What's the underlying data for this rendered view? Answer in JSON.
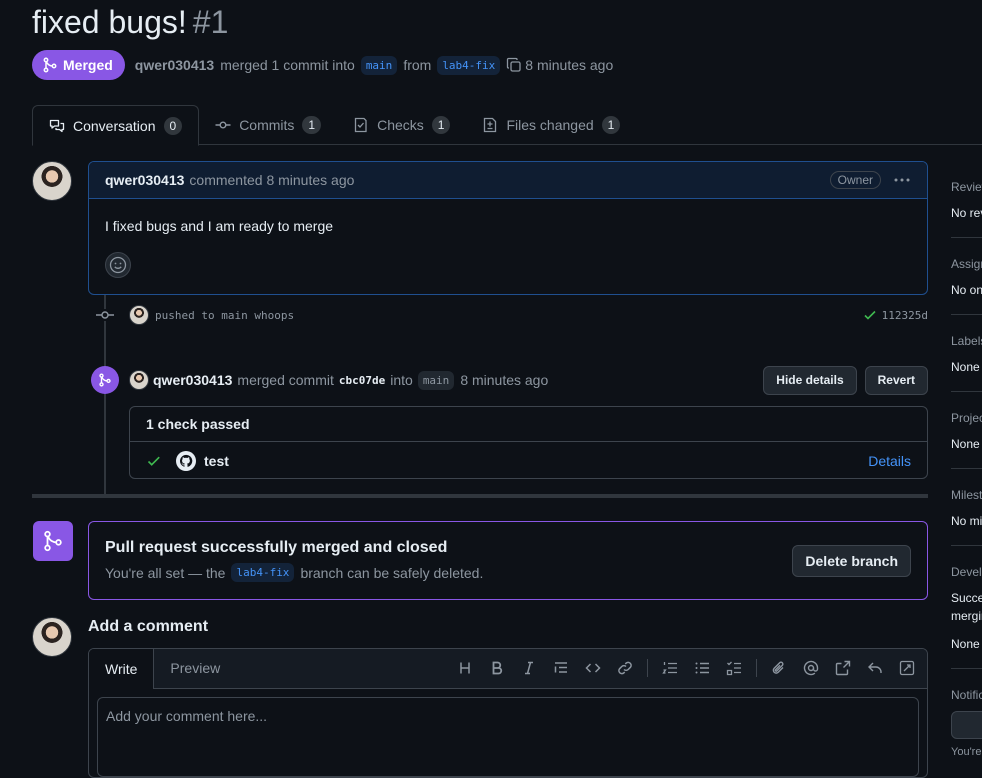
{
  "pr": {
    "title": "fixed bugs!",
    "number": "#1",
    "state": "Merged",
    "author": "qwer030413",
    "merged_text": "merged 1 commit into",
    "base_branch": "main",
    "from_text": "from",
    "head_branch": "lab4-fix",
    "time": "8 minutes ago"
  },
  "tabs": [
    {
      "label": "Conversation",
      "count": "0",
      "icon": "conversation-icon"
    },
    {
      "label": "Commits",
      "count": "1",
      "icon": "commit-icon"
    },
    {
      "label": "Checks",
      "count": "1",
      "icon": "checklist-icon"
    },
    {
      "label": "Files changed",
      "count": "1",
      "icon": "file-diff-icon"
    }
  ],
  "comment": {
    "author": "qwer030413",
    "action": "commented 8 minutes ago",
    "role": "Owner",
    "body": "I fixed bugs and I am ready to merge"
  },
  "push": {
    "text": "pushed to main whoops",
    "sha": "112325d"
  },
  "merge_event": {
    "author": "qwer030413",
    "action": "merged commit",
    "commit": "cbc07de",
    "into": "into",
    "branch": "main",
    "time": "8 minutes ago",
    "hide_details": "Hide details",
    "revert": "Revert"
  },
  "checks": {
    "header": "1 check passed",
    "name": "test",
    "details": "Details"
  },
  "merged_box": {
    "title": "Pull request successfully merged and closed",
    "desc_before": "You're all set — the",
    "branch": "lab4-fix",
    "desc_after": "branch can be safely deleted.",
    "delete_button": "Delete branch"
  },
  "add_comment": {
    "heading": "Add a comment",
    "write": "Write",
    "preview": "Preview",
    "placeholder": "Add your comment here..."
  },
  "sidebar": [
    {
      "heading": "Reviewers",
      "value": "No reviews"
    },
    {
      "heading": "Assignees",
      "value": "No one assigned"
    },
    {
      "heading": "Labels",
      "value": "None yet"
    },
    {
      "heading": "Projects",
      "value": "None yet"
    },
    {
      "heading": "Milestone",
      "value": "No milestone"
    },
    {
      "heading": "Development",
      "value": "Successfully merging this pull request may close these issues.",
      "value2": "None yet"
    },
    {
      "heading": "Notifications",
      "value": "You're"
    }
  ],
  "colors": {
    "merged": "#8957e5",
    "link": "#4493f8",
    "success": "#3fb950"
  }
}
